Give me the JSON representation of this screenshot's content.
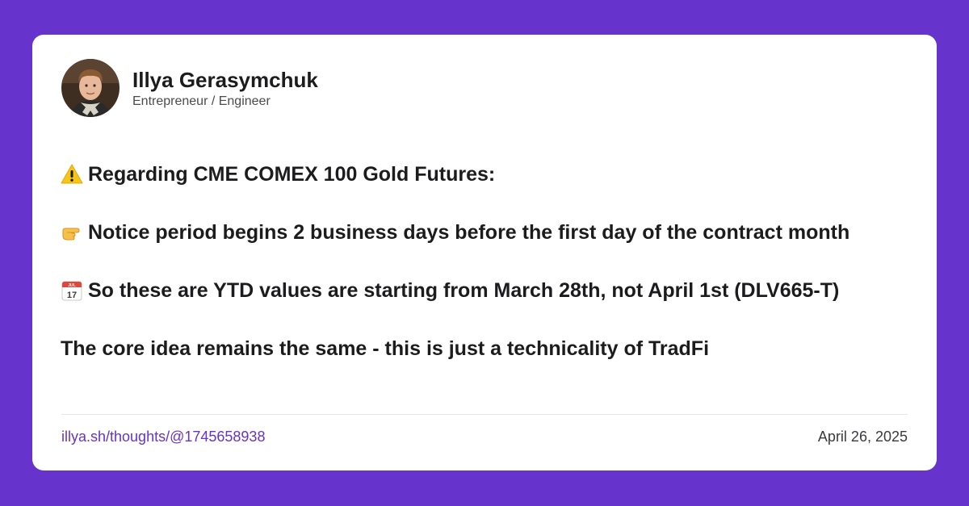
{
  "author": {
    "name": "Illya Gerasymchuk",
    "role": "Entrepreneur / Engineer"
  },
  "post": {
    "line1": {
      "icon": "warning-icon",
      "text": "Regarding CME COMEX 100 Gold Futures:"
    },
    "line2": {
      "icon": "pointing-hand-icon",
      "text": "Notice period begins 2 business days before the first day of the contract month"
    },
    "line3": {
      "icon": "calendar-icon",
      "calendar_label": "17",
      "calendar_month": "JUL",
      "text": "So these are YTD values are starting from March 28th, not April 1st (DLV665-T)"
    },
    "line4": {
      "text": "The core idea remains the same - this is just a technicality of TradFi"
    }
  },
  "footer": {
    "link": "illya.sh/thoughts/@1745658938",
    "date": "April 26, 2025"
  },
  "colors": {
    "background": "#6633cc",
    "card": "#ffffff",
    "link": "#6633cc"
  }
}
